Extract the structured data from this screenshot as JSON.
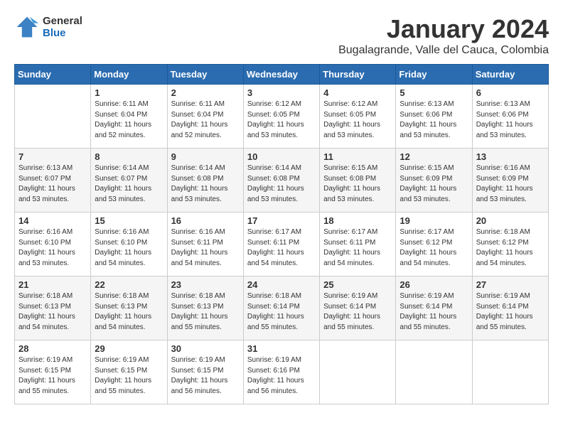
{
  "header": {
    "logo": {
      "general": "General",
      "blue": "Blue"
    },
    "month": "January 2024",
    "location": "Bugalagrande, Valle del Cauca, Colombia"
  },
  "weekdays": [
    "Sunday",
    "Monday",
    "Tuesday",
    "Wednesday",
    "Thursday",
    "Friday",
    "Saturday"
  ],
  "weeks": [
    [
      {
        "day": "",
        "info": ""
      },
      {
        "day": "1",
        "info": "Sunrise: 6:11 AM\nSunset: 6:04 PM\nDaylight: 11 hours\nand 52 minutes."
      },
      {
        "day": "2",
        "info": "Sunrise: 6:11 AM\nSunset: 6:04 PM\nDaylight: 11 hours\nand 52 minutes."
      },
      {
        "day": "3",
        "info": "Sunrise: 6:12 AM\nSunset: 6:05 PM\nDaylight: 11 hours\nand 53 minutes."
      },
      {
        "day": "4",
        "info": "Sunrise: 6:12 AM\nSunset: 6:05 PM\nDaylight: 11 hours\nand 53 minutes."
      },
      {
        "day": "5",
        "info": "Sunrise: 6:13 AM\nSunset: 6:06 PM\nDaylight: 11 hours\nand 53 minutes."
      },
      {
        "day": "6",
        "info": "Sunrise: 6:13 AM\nSunset: 6:06 PM\nDaylight: 11 hours\nand 53 minutes."
      }
    ],
    [
      {
        "day": "7",
        "info": "Sunrise: 6:13 AM\nSunset: 6:07 PM\nDaylight: 11 hours\nand 53 minutes."
      },
      {
        "day": "8",
        "info": "Sunrise: 6:14 AM\nSunset: 6:07 PM\nDaylight: 11 hours\nand 53 minutes."
      },
      {
        "day": "9",
        "info": "Sunrise: 6:14 AM\nSunset: 6:08 PM\nDaylight: 11 hours\nand 53 minutes."
      },
      {
        "day": "10",
        "info": "Sunrise: 6:14 AM\nSunset: 6:08 PM\nDaylight: 11 hours\nand 53 minutes."
      },
      {
        "day": "11",
        "info": "Sunrise: 6:15 AM\nSunset: 6:08 PM\nDaylight: 11 hours\nand 53 minutes."
      },
      {
        "day": "12",
        "info": "Sunrise: 6:15 AM\nSunset: 6:09 PM\nDaylight: 11 hours\nand 53 minutes."
      },
      {
        "day": "13",
        "info": "Sunrise: 6:16 AM\nSunset: 6:09 PM\nDaylight: 11 hours\nand 53 minutes."
      }
    ],
    [
      {
        "day": "14",
        "info": "Sunrise: 6:16 AM\nSunset: 6:10 PM\nDaylight: 11 hours\nand 53 minutes."
      },
      {
        "day": "15",
        "info": "Sunrise: 6:16 AM\nSunset: 6:10 PM\nDaylight: 11 hours\nand 54 minutes."
      },
      {
        "day": "16",
        "info": "Sunrise: 6:16 AM\nSunset: 6:11 PM\nDaylight: 11 hours\nand 54 minutes."
      },
      {
        "day": "17",
        "info": "Sunrise: 6:17 AM\nSunset: 6:11 PM\nDaylight: 11 hours\nand 54 minutes."
      },
      {
        "day": "18",
        "info": "Sunrise: 6:17 AM\nSunset: 6:11 PM\nDaylight: 11 hours\nand 54 minutes."
      },
      {
        "day": "19",
        "info": "Sunrise: 6:17 AM\nSunset: 6:12 PM\nDaylight: 11 hours\nand 54 minutes."
      },
      {
        "day": "20",
        "info": "Sunrise: 6:18 AM\nSunset: 6:12 PM\nDaylight: 11 hours\nand 54 minutes."
      }
    ],
    [
      {
        "day": "21",
        "info": "Sunrise: 6:18 AM\nSunset: 6:13 PM\nDaylight: 11 hours\nand 54 minutes."
      },
      {
        "day": "22",
        "info": "Sunrise: 6:18 AM\nSunset: 6:13 PM\nDaylight: 11 hours\nand 54 minutes."
      },
      {
        "day": "23",
        "info": "Sunrise: 6:18 AM\nSunset: 6:13 PM\nDaylight: 11 hours\nand 55 minutes."
      },
      {
        "day": "24",
        "info": "Sunrise: 6:18 AM\nSunset: 6:14 PM\nDaylight: 11 hours\nand 55 minutes."
      },
      {
        "day": "25",
        "info": "Sunrise: 6:19 AM\nSunset: 6:14 PM\nDaylight: 11 hours\nand 55 minutes."
      },
      {
        "day": "26",
        "info": "Sunrise: 6:19 AM\nSunset: 6:14 PM\nDaylight: 11 hours\nand 55 minutes."
      },
      {
        "day": "27",
        "info": "Sunrise: 6:19 AM\nSunset: 6:14 PM\nDaylight: 11 hours\nand 55 minutes."
      }
    ],
    [
      {
        "day": "28",
        "info": "Sunrise: 6:19 AM\nSunset: 6:15 PM\nDaylight: 11 hours\nand 55 minutes."
      },
      {
        "day": "29",
        "info": "Sunrise: 6:19 AM\nSunset: 6:15 PM\nDaylight: 11 hours\nand 55 minutes."
      },
      {
        "day": "30",
        "info": "Sunrise: 6:19 AM\nSunset: 6:15 PM\nDaylight: 11 hours\nand 56 minutes."
      },
      {
        "day": "31",
        "info": "Sunrise: 6:19 AM\nSunset: 6:16 PM\nDaylight: 11 hours\nand 56 minutes."
      },
      {
        "day": "",
        "info": ""
      },
      {
        "day": "",
        "info": ""
      },
      {
        "day": "",
        "info": ""
      }
    ]
  ]
}
